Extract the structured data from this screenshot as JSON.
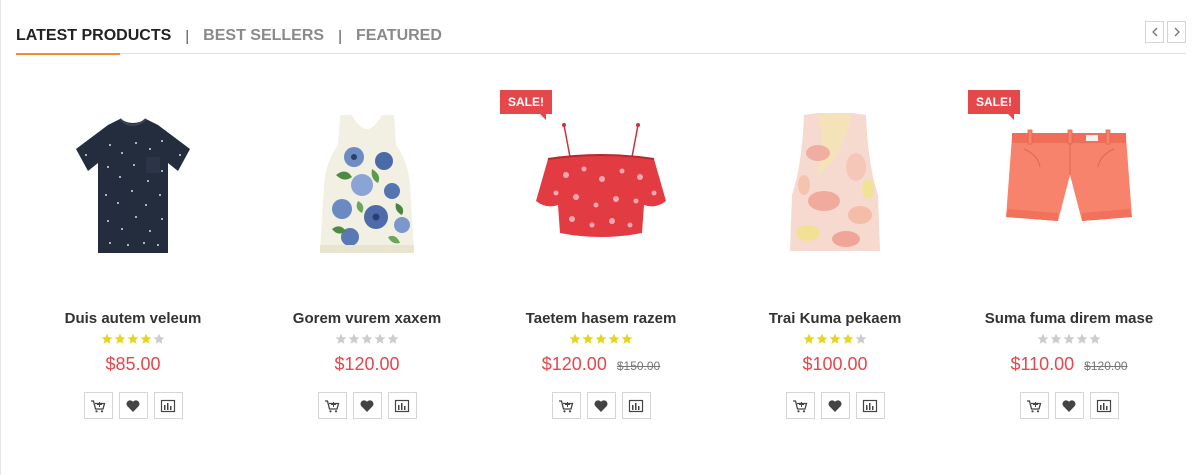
{
  "tabs": {
    "latest": "LATEST PRODUCTS",
    "best": "BEST SELLERS",
    "featured": "FEATURED",
    "separator": "|"
  },
  "nav": {
    "prev_icon": "chevron-left-icon",
    "next_icon": "chevron-right-icon"
  },
  "colors": {
    "accent": "#f18d2c",
    "price": "#e5474b",
    "sale_badge": "#e5474b",
    "star_on": "#e6d51b",
    "star_off": "#cccccc"
  },
  "products": [
    {
      "name": "Duis autem veleum",
      "rating": 4,
      "price": "$85.00",
      "old_price": "",
      "sale": "",
      "image": "navy-dotted-tshirt"
    },
    {
      "name": "Gorem vurem xaxem",
      "rating": 0,
      "price": "$120.00",
      "old_price": "",
      "sale": "",
      "image": "floral-tank-top"
    },
    {
      "name": "Taetem hasem razem",
      "rating": 5,
      "price": "$120.00",
      "old_price": "$150.00",
      "sale": "SALE!",
      "image": "red-off-shoulder-blouse"
    },
    {
      "name": "Trai Kuma pekaem",
      "rating": 4,
      "price": "$100.00",
      "old_price": "",
      "sale": "",
      "image": "pastel-print-top"
    },
    {
      "name": "Suma fuma direm mase",
      "rating": 0,
      "price": "$110.00",
      "old_price": "$120.00",
      "sale": "SALE!",
      "image": "coral-shorts"
    }
  ],
  "actions": [
    "add-to-cart-icon",
    "wishlist-heart-icon",
    "compare-chart-icon"
  ]
}
